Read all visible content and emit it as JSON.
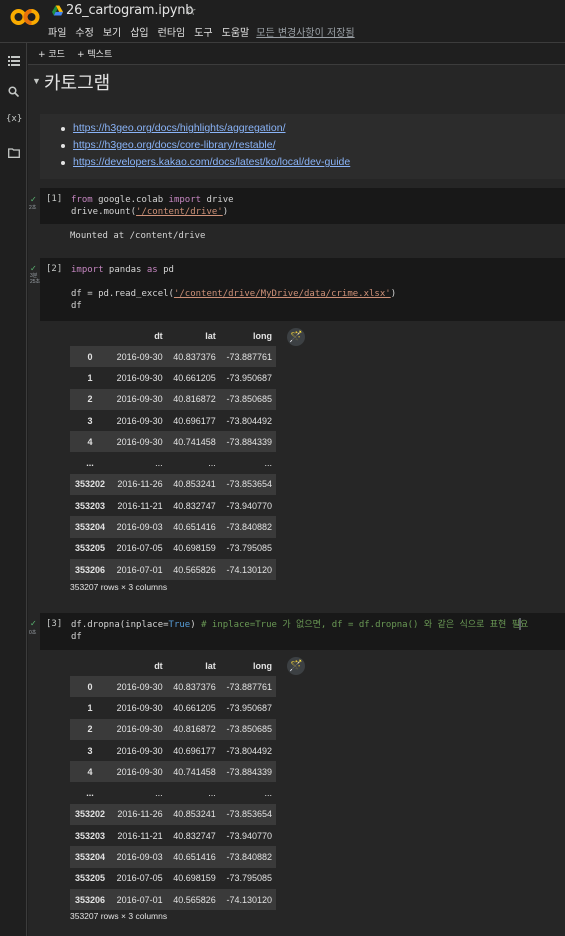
{
  "header": {
    "title": "26_cartogram.ipynb",
    "menu": [
      "파일",
      "수정",
      "보기",
      "삽입",
      "런타임",
      "도구",
      "도움말"
    ],
    "saved_status": "모든 변경사항이 저장됨"
  },
  "toolbar": {
    "code_label": "+ 코드",
    "text_label": "+ 텍스트"
  },
  "section": {
    "title": "카토그램"
  },
  "links": [
    "https://h3geo.org/docs/highlights/aggregation/",
    "https://h3geo.org/docs/core-library/restable/",
    "https://developers.kakao.com/docs/latest/ko/local/dev-guide"
  ],
  "cells": [
    {
      "num": "[1]",
      "time": "2초",
      "output": "Mounted at /content/drive"
    },
    {
      "num": "[2]",
      "time": "3분\n25초"
    },
    {
      "num": "[3]",
      "time": "0초"
    }
  ],
  "code": {
    "c1_kw1": "from",
    "c1_t1": " google.colab ",
    "c1_kw2": "import",
    "c1_t2": " drive",
    "c1_l2a": "drive.mount(",
    "c1_str": "'/content/drive'",
    "c1_l2b": ")",
    "c2_kw1": "import",
    "c2_t1": " pandas ",
    "c2_kw2": "as",
    "c2_t2": " pd",
    "c2_l2a": "df = pd.read_excel(",
    "c2_str": "'/content/drive/MyDrive/data/crime.xlsx'",
    "c2_l2b": ")",
    "c2_l3": "df",
    "c3_l1a": "df.dropna(inplace=",
    "c3_bi": "True",
    "c3_l1b": ") ",
    "c3_cm": "# inplace=True 가 없으면, df = df.dropna() 와 같은 식으로 표현 필요",
    "c3_l2": "df"
  },
  "table": {
    "columns": [
      "",
      "dt",
      "lat",
      "long"
    ],
    "rows": [
      [
        "0",
        "2016-09-30",
        "40.837376",
        "-73.887761"
      ],
      [
        "1",
        "2016-09-30",
        "40.661205",
        "-73.950687"
      ],
      [
        "2",
        "2016-09-30",
        "40.816872",
        "-73.850685"
      ],
      [
        "3",
        "2016-09-30",
        "40.696177",
        "-73.804492"
      ],
      [
        "4",
        "2016-09-30",
        "40.741458",
        "-73.884339"
      ],
      [
        "...",
        "...",
        "...",
        "..."
      ],
      [
        "353202",
        "2016-11-26",
        "40.853241",
        "-73.853654"
      ],
      [
        "353203",
        "2016-11-21",
        "40.832747",
        "-73.940770"
      ],
      [
        "353204",
        "2016-09-03",
        "40.651416",
        "-73.840882"
      ],
      [
        "353205",
        "2016-07-05",
        "40.698159",
        "-73.795085"
      ],
      [
        "353206",
        "2016-07-01",
        "40.565826",
        "-74.130120"
      ]
    ],
    "shape": "353207 rows × 3 columns"
  },
  "colors": {
    "link": "#8ab4f8",
    "keyword": "#c586c0",
    "string": "#ce9178",
    "comment": "#6a9955",
    "check": "#5bb974"
  },
  "icons": [
    "colab-logo",
    "drive-icon",
    "star-icon",
    "toc-icon",
    "search-icon",
    "variables-icon",
    "folder-icon",
    "magic-wand-icon",
    "check-icon"
  ]
}
